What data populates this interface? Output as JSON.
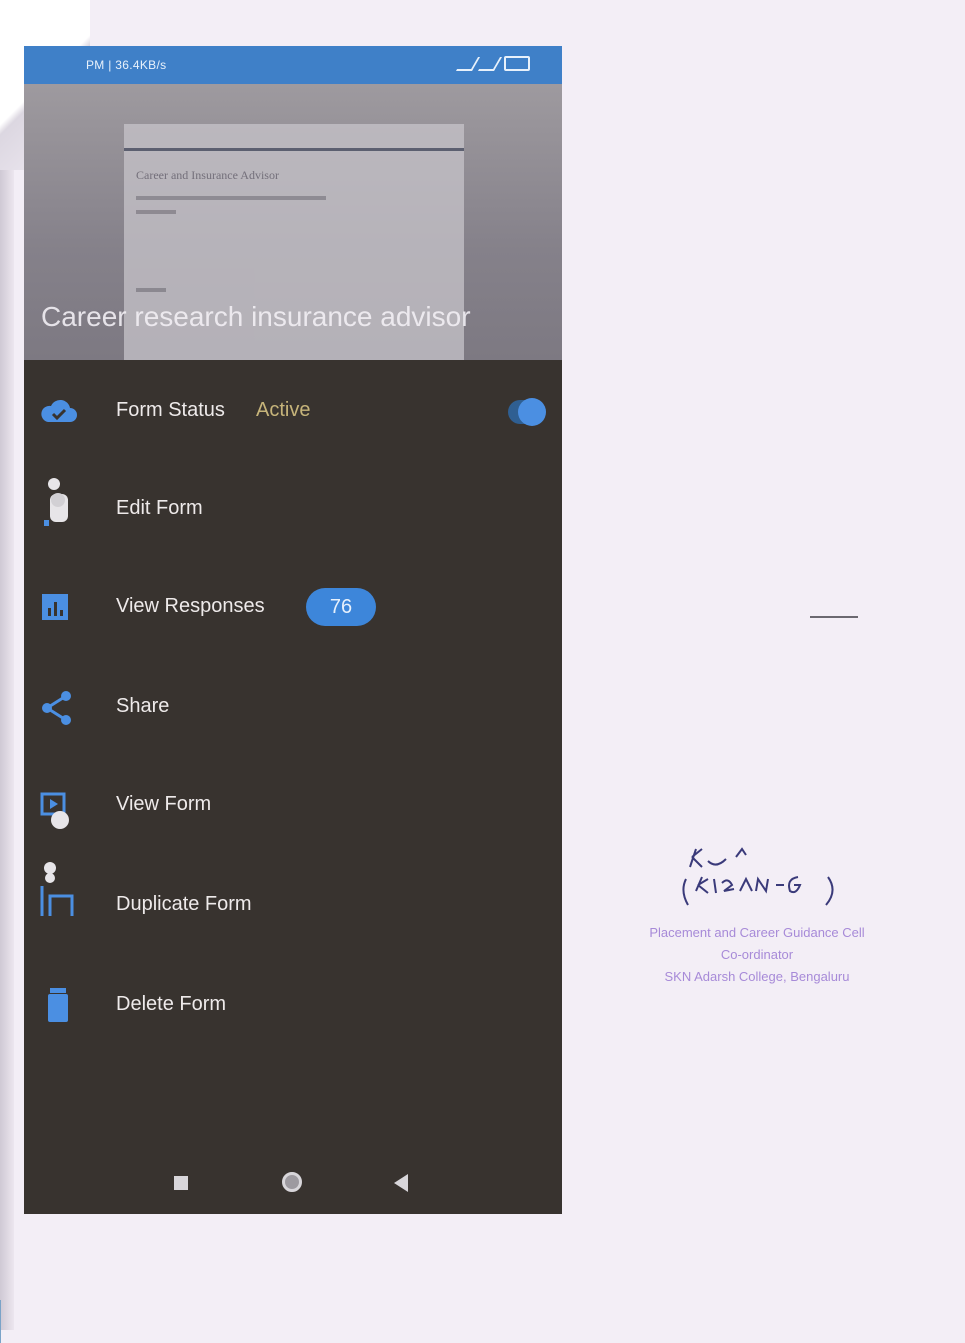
{
  "status_bar": {
    "left_text": "PM | 36.4KB/s",
    "right_icons": [
      "signal-icon",
      "signal-icon",
      "battery-icon"
    ]
  },
  "header": {
    "title": "Career research insurance advisor",
    "preview_heading": "Career and Insurance Advisor"
  },
  "menu": {
    "items": [
      {
        "label": "Form Status",
        "icon": "cloud-check-icon"
      },
      {
        "label": "Edit Form",
        "icon": "edit-icon"
      },
      {
        "label": "View Responses",
        "icon": "bar-chart-icon"
      },
      {
        "label": "Share",
        "icon": "share-icon"
      },
      {
        "label": "View Form",
        "icon": "preview-icon"
      },
      {
        "label": "Duplicate Form",
        "icon": "copy-icon"
      },
      {
        "label": "Delete Form",
        "icon": "trash-icon"
      }
    ],
    "status_value": "Active",
    "responses_count": "76",
    "toggle_on": true
  },
  "signature": {
    "name": "(KIRAN G)",
    "stamp_line1": "Placement and Career Guidance Cell",
    "stamp_line2": "Co-ordinator",
    "stamp_line3": "SKN Adarsh College, Bengaluru"
  },
  "colors": {
    "accent": "#3d86da",
    "drawer_bg": "#38332f",
    "status_active": "#c6b47a",
    "stamp": "#a78ad8"
  }
}
